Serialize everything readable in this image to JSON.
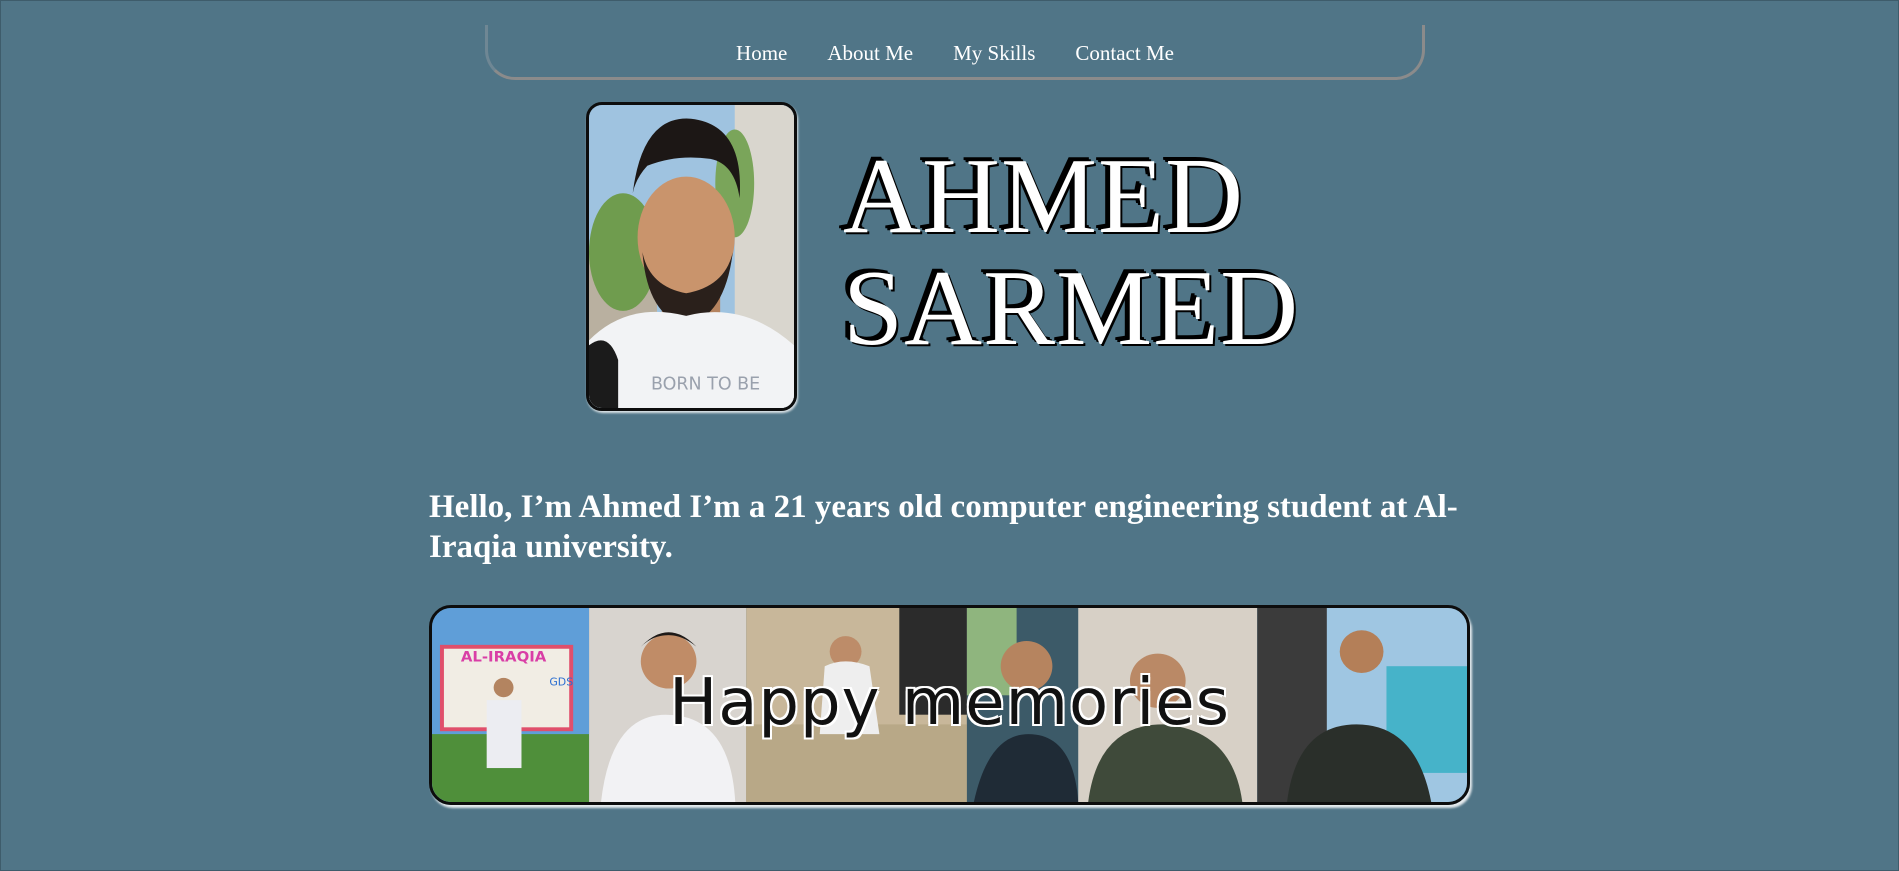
{
  "nav": {
    "items": [
      {
        "label": "Home"
      },
      {
        "label": "About Me"
      },
      {
        "label": "My Skills"
      },
      {
        "label": "Contact Me"
      }
    ]
  },
  "hero": {
    "first_name": "AHMED",
    "last_name": "SARMED",
    "photo_shirt_text": "BORN TO BE"
  },
  "intro": {
    "text": "Hello, I’m Ahmed I’m a 21 years old computer engineering student at Al-Iraqia university."
  },
  "memories": {
    "caption": "Happy memories",
    "sign_text": "AL-IRAQIA",
    "sign_side_text": "GDS"
  },
  "colors": {
    "background": "#507587",
    "text": "#ffffff",
    "frame": "#0d0d0d"
  }
}
